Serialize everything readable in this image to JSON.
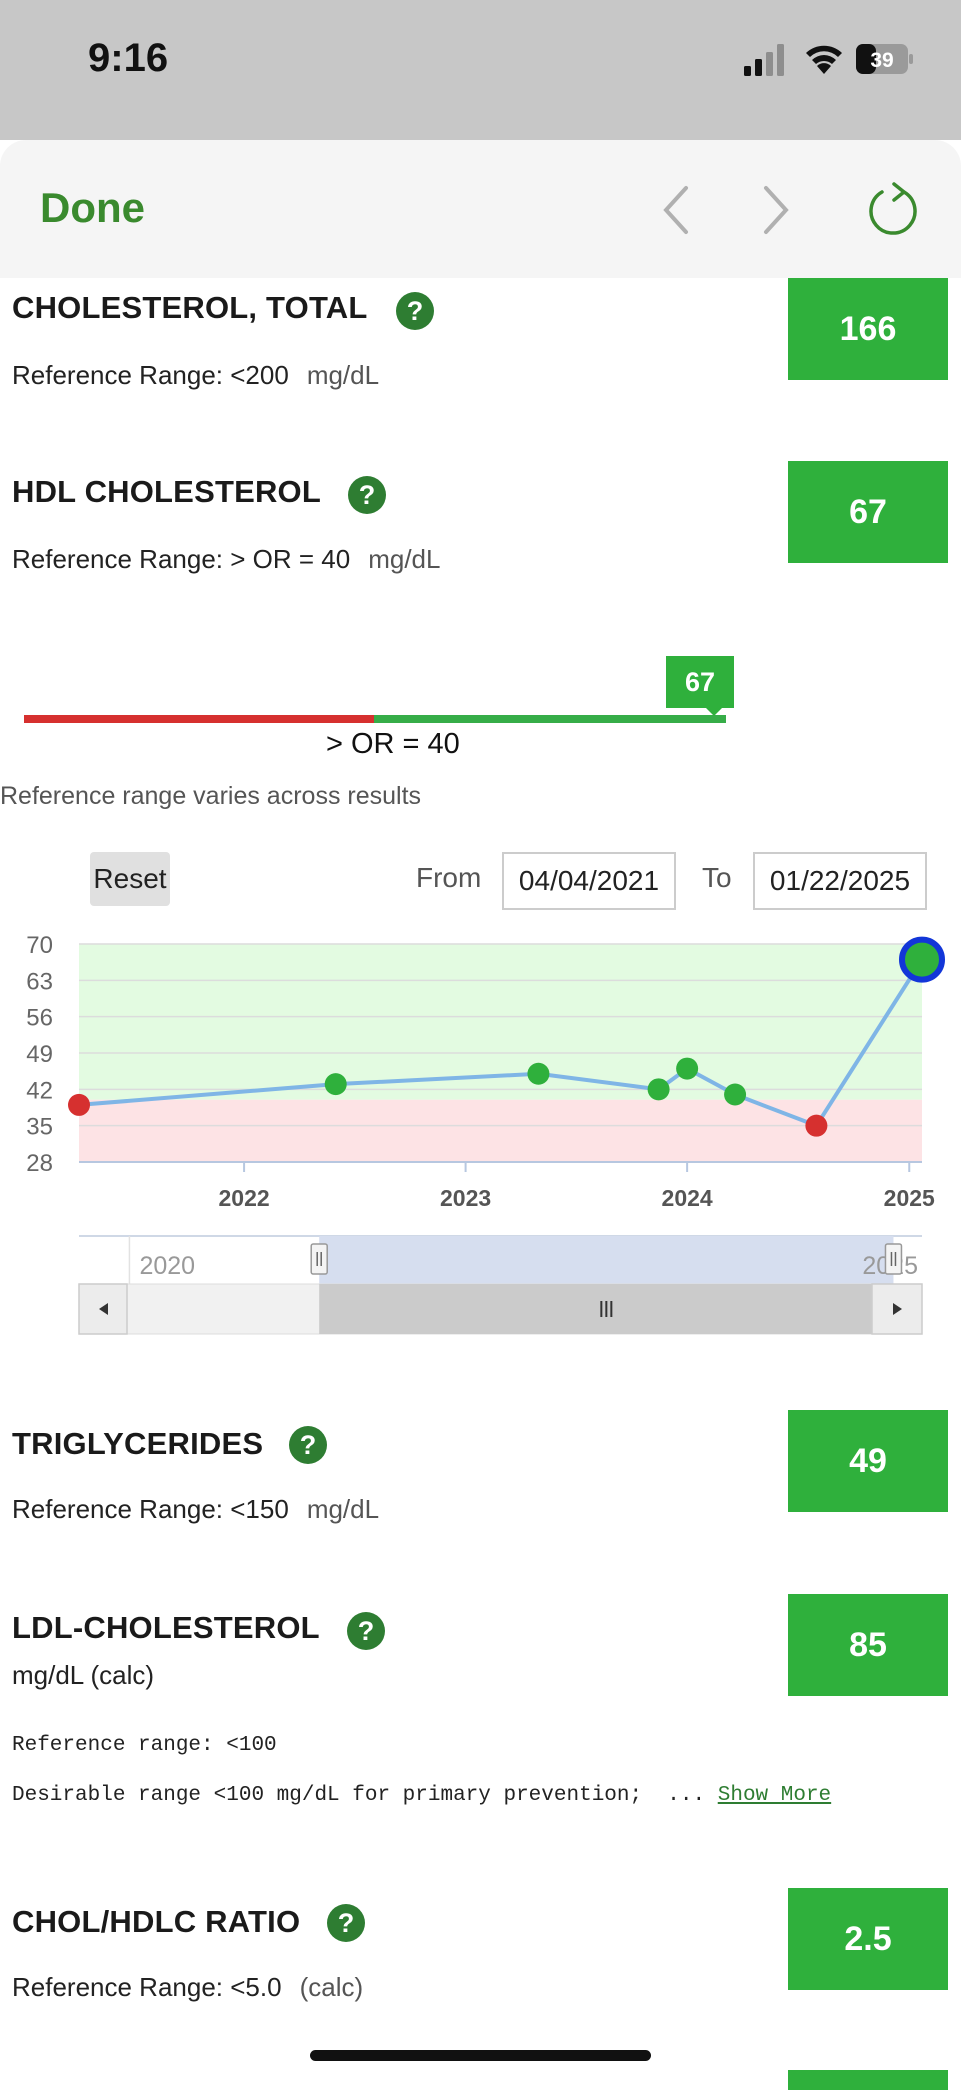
{
  "status_bar": {
    "time": "9:16",
    "battery": "39"
  },
  "nav": {
    "done_label": "Done"
  },
  "results": [
    {
      "name": "CHOLESTEROL, TOTAL",
      "value": "166",
      "reference": "Reference Range: <200",
      "unit": "mg/dL"
    },
    {
      "name": "HDL CHOLESTEROL",
      "value": "67",
      "reference": "Reference Range: > OR = 40",
      "unit": "mg/dL"
    },
    {
      "name": "TRIGLYCERIDES",
      "value": "49",
      "reference": "Reference Range: <150",
      "unit": "mg/dL"
    },
    {
      "name": "LDL-CHOLESTEROL",
      "value": "85",
      "unit_line": "mg/dL (calc)",
      "reference_mono": "Reference range: <100",
      "note": "Desirable range <100 mg/dL for primary prevention;  ...",
      "show_more": "Show More"
    },
    {
      "name": "CHOL/HDLC RATIO",
      "value": "2.5",
      "reference": "Reference Range: <5.0",
      "unit": "(calc)"
    }
  ],
  "range_bar": {
    "marker_value": "67",
    "threshold_label": "> OR = 40",
    "threshold": 40,
    "note": "Reference range varies across results"
  },
  "date_range": {
    "reset_label": "Reset",
    "from_label": "From",
    "from_value": "04/04/2021",
    "to_label": "To",
    "to_value": "01/22/2025"
  },
  "colors": {
    "accent_green": "#3a8a2e",
    "value_green": "#2fb03c",
    "out_of_range_red": "#d6302f",
    "normal_band": "#e3fbe1",
    "low_band": "#fde3e5",
    "line": "#7fb5e6"
  },
  "chart_data": {
    "type": "line",
    "y_ticks": [
      70,
      63,
      56,
      49,
      42,
      35,
      28
    ],
    "ylim": [
      28,
      70
    ],
    "x_ticks": [
      "2022",
      "2023",
      "2024",
      "2025"
    ],
    "xlim": [
      "2021-04-04",
      "2025-01-22"
    ],
    "normal_range_min": 40,
    "series": [
      {
        "points": [
          {
            "date": "2021-04-04",
            "value": 39,
            "flag": "low"
          },
          {
            "date": "2022-06-01",
            "value": 43,
            "flag": "normal"
          },
          {
            "date": "2023-05-01",
            "value": 45,
            "flag": "normal"
          },
          {
            "date": "2023-11-15",
            "value": 42,
            "flag": "normal"
          },
          {
            "date": "2024-01-01",
            "value": 46,
            "flag": "normal"
          },
          {
            "date": "2024-03-20",
            "value": 41,
            "flag": "normal"
          },
          {
            "date": "2024-08-01",
            "value": 35,
            "flag": "low"
          },
          {
            "date": "2025-01-22",
            "value": 67,
            "flag": "current"
          }
        ]
      }
    ],
    "navigator": {
      "labels": [
        "2020",
        "2025"
      ],
      "selected_range": [
        "2021-04-04",
        "2025-01-22"
      ]
    }
  }
}
